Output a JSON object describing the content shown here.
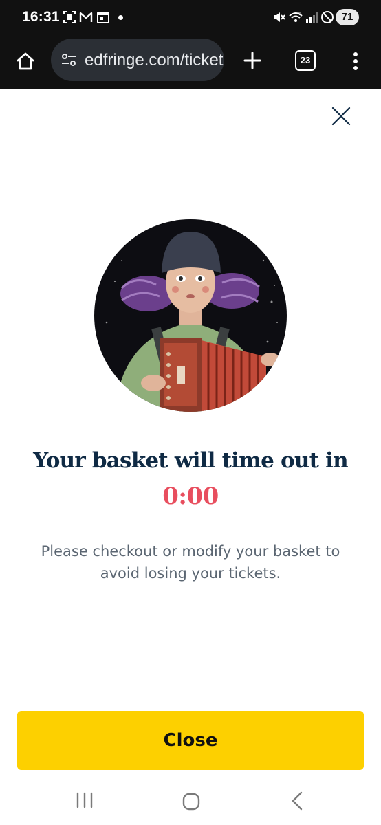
{
  "status_bar": {
    "time": "16:31",
    "battery": "71",
    "icons": [
      "screenshot-icon",
      "gmail-icon",
      "calendar-icon",
      "notification-dot",
      "mute-icon",
      "wifi-icon",
      "signal-icon",
      "dnd-icon"
    ]
  },
  "browser": {
    "url": "edfringe.com/tickets",
    "tab_count": "23",
    "icons": [
      "home-icon",
      "site-settings-icon",
      "plus-icon",
      "tabs-icon",
      "more-vert-icon"
    ]
  },
  "modal": {
    "title": "Your basket will time out in",
    "countdown": "0:00",
    "message": "Please checkout or modify your basket to avoid losing your tickets.",
    "close_label": "Close"
  },
  "nav_bar": {
    "icons": [
      "recents-icon",
      "home-circle-icon",
      "back-icon"
    ]
  },
  "colors": {
    "title": "#0f2a44",
    "countdown": "#e84e5e",
    "message": "#5b6672",
    "button": "#fdd000",
    "toolbar": "#111111"
  }
}
